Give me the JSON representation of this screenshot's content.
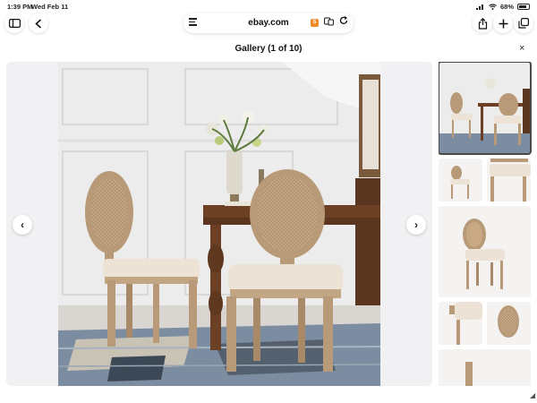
{
  "status_bar": {
    "time": "1:39 PM",
    "date": "Wed Feb 11",
    "battery": "68%"
  },
  "browser": {
    "domain": "ebay.com",
    "extension_badge": "S"
  },
  "gallery": {
    "title": "Gallery (1 of 10)",
    "prev_glyph": "‹",
    "next_glyph": "›",
    "close_glyph": "×"
  },
  "icons": {
    "sidebar": "sidebar-icon",
    "back": "chevron-left-icon",
    "share": "share-icon",
    "new_tab": "plus-icon",
    "tabs": "tabs-icon",
    "reader": "reader-icon",
    "translate": "translate-icon",
    "reload": "reload-icon"
  },
  "colors": {
    "accent": "#f08a24",
    "wall": "#eeeeee",
    "table": "#6b4024",
    "chair_frame": "#b89a78",
    "seat": "#ece3d6",
    "rug": "#6b7f95"
  }
}
